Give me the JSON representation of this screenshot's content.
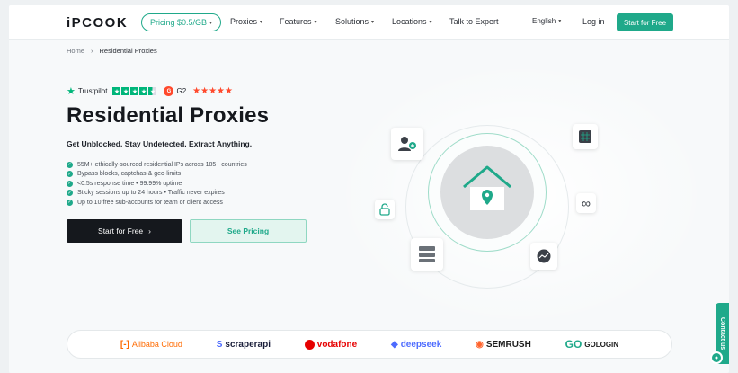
{
  "nav": {
    "logo": "iPCOOK",
    "pricing_pill": "Pricing $0.5/GB",
    "items": [
      "Proxies",
      "Features",
      "Solutions",
      "Locations",
      "Talk to Expert"
    ],
    "language": "English",
    "login": "Log in",
    "cta": "Start for Free"
  },
  "breadcrumb": {
    "home": "Home",
    "sep": "›",
    "current": "Residential Proxies"
  },
  "ratings": {
    "trustpilot": "Trustpilot",
    "g2": "G2"
  },
  "hero": {
    "title": "Residential Proxies",
    "subtitle": "Get Unblocked. Stay Undetected. Extract Anything.",
    "features": [
      "55M+ ethically-sourced residential IPs across 185+ countries",
      "Bypass blocks, captchas & geo-limits",
      "<0.5s response time • 99.99% uptime",
      "Sticky sessions up to 24 hours • Traffic never expires",
      "Up to 10 free sub-accounts for team or client access"
    ],
    "primary_button": "Start for Free",
    "secondary_button": "See Pricing"
  },
  "partners": [
    {
      "name": "Alibaba Cloud",
      "color": "#ff6a00"
    },
    {
      "name": "scraperapi",
      "color": "#1b1f3b"
    },
    {
      "name": "vodafone",
      "color": "#e60000"
    },
    {
      "name": "deepseek",
      "color": "#4d6bfe"
    },
    {
      "name": "SEMRUSH",
      "color": "#1d1d1d"
    },
    {
      "name": "GOLOGIN",
      "color": "#1d1d1d"
    }
  ],
  "contact": "Contact us",
  "colors": {
    "accent": "#1fa98a",
    "dark": "#15181d"
  }
}
